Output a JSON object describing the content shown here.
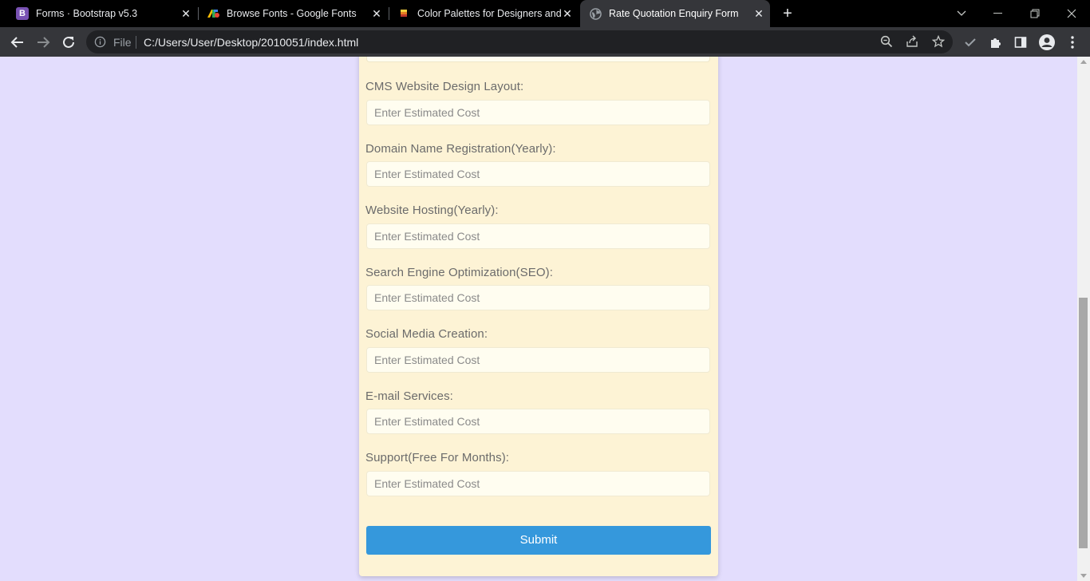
{
  "browser": {
    "tabs": [
      {
        "title": "Forms · Bootstrap v5.3",
        "favicon": "bootstrap-icon",
        "favicon_color": "#7952b3"
      },
      {
        "title": "Browse Fonts - Google Fonts",
        "favicon": "google-fonts-icon",
        "favicon_color": "#4285f4"
      },
      {
        "title": "Color Palettes for Designers and",
        "favicon": "palette-icon",
        "favicon_color": "#e8b923"
      },
      {
        "title": "Rate Quotation Enquiry Form",
        "favicon": "globe-icon",
        "favicon_color": "#9aa0a6",
        "active": true
      }
    ],
    "omnibox": {
      "scheme_label": "File",
      "url": "C:/Users/User/Desktop/2010051/index.html"
    }
  },
  "form": {
    "fields": [
      {
        "label": "CMS Website Design Layout:",
        "placeholder": "Enter Estimated Cost"
      },
      {
        "label": "Domain Name Registration(Yearly):",
        "placeholder": "Enter Estimated Cost"
      },
      {
        "label": "Website Hosting(Yearly):",
        "placeholder": "Enter Estimated Cost"
      },
      {
        "label": "Search Engine Optimization(SEO):",
        "placeholder": "Enter Estimated Cost"
      },
      {
        "label": "Social Media Creation:",
        "placeholder": "Enter Estimated Cost"
      },
      {
        "label": "E-mail Services:",
        "placeholder": "Enter Estimated Cost"
      },
      {
        "label": "Support(Free For Months):",
        "placeholder": "Enter Estimated Cost"
      }
    ],
    "submit_label": "Submit"
  },
  "colors": {
    "page_background": "#e3ddfd",
    "card_background": "#fdf3d5",
    "input_background": "#fffdf0",
    "submit_button": "#3598dc",
    "label_text": "#6b6b6b"
  }
}
